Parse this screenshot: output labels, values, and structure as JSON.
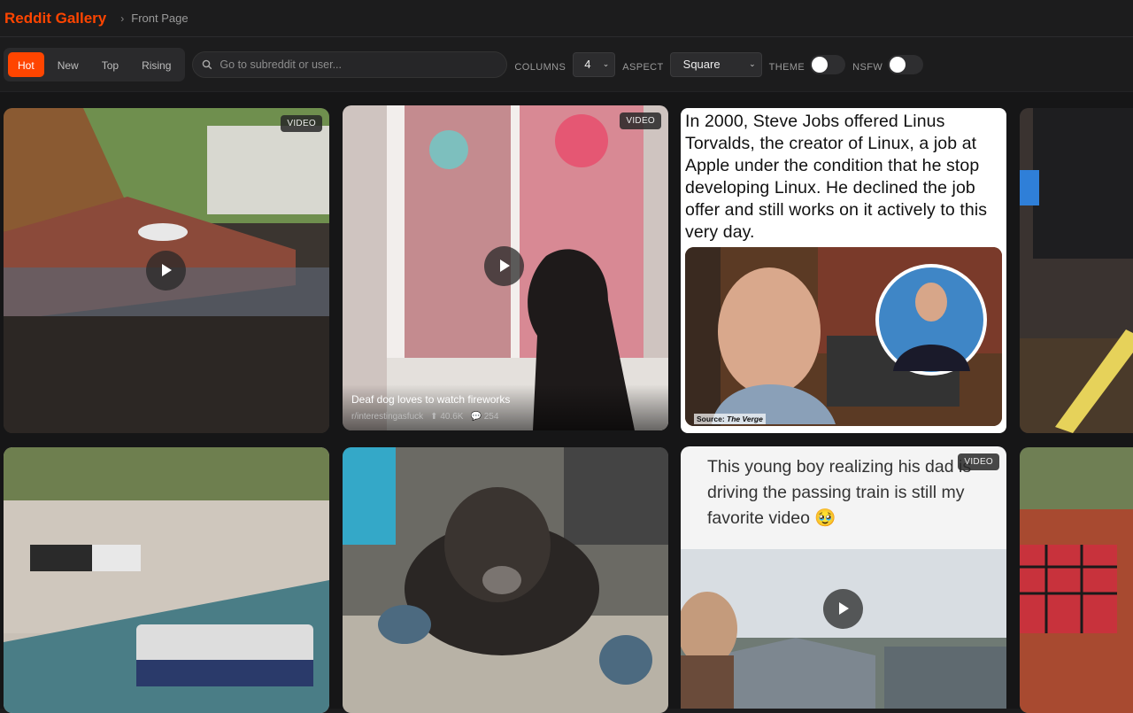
{
  "header": {
    "brand": "Reddit Gallery",
    "separator": "›",
    "crumb": "Front Page"
  },
  "toolbar": {
    "sorts": [
      {
        "label": "Hot",
        "active": true
      },
      {
        "label": "New",
        "active": false
      },
      {
        "label": "Top",
        "active": false
      },
      {
        "label": "Rising",
        "active": false
      }
    ],
    "search_placeholder": "Go to subreddit or user...",
    "columns_label": "COLUMNS",
    "columns_value": "4",
    "aspect_label": "ASPECT",
    "aspect_value": "Square",
    "theme_label": "THEME",
    "theme_on": false,
    "nsfw_label": "NSFW",
    "nsfw_on": false
  },
  "accent": "#ff4500",
  "cards": {
    "c1": {
      "badge": "VIDEO"
    },
    "c2": {
      "badge": "VIDEO",
      "title": "Deaf dog loves to watch fireworks",
      "subreddit": "r/interestingasfuck",
      "upvotes": "40.6K",
      "comments": "254"
    },
    "c3": {
      "text": "In 2000, Steve Jobs offered Linus Torvalds, the creator of Linux, a job at Apple under the condition that he stop developing Linux. He declined the job offer and still works on it actively to this very day.",
      "source_label": "Source:",
      "source_name": "The Verge"
    },
    "c7": {
      "badge": "VIDEO",
      "text": "This young boy realizing his dad is driving the passing train is still my favorite video 🥹"
    }
  }
}
